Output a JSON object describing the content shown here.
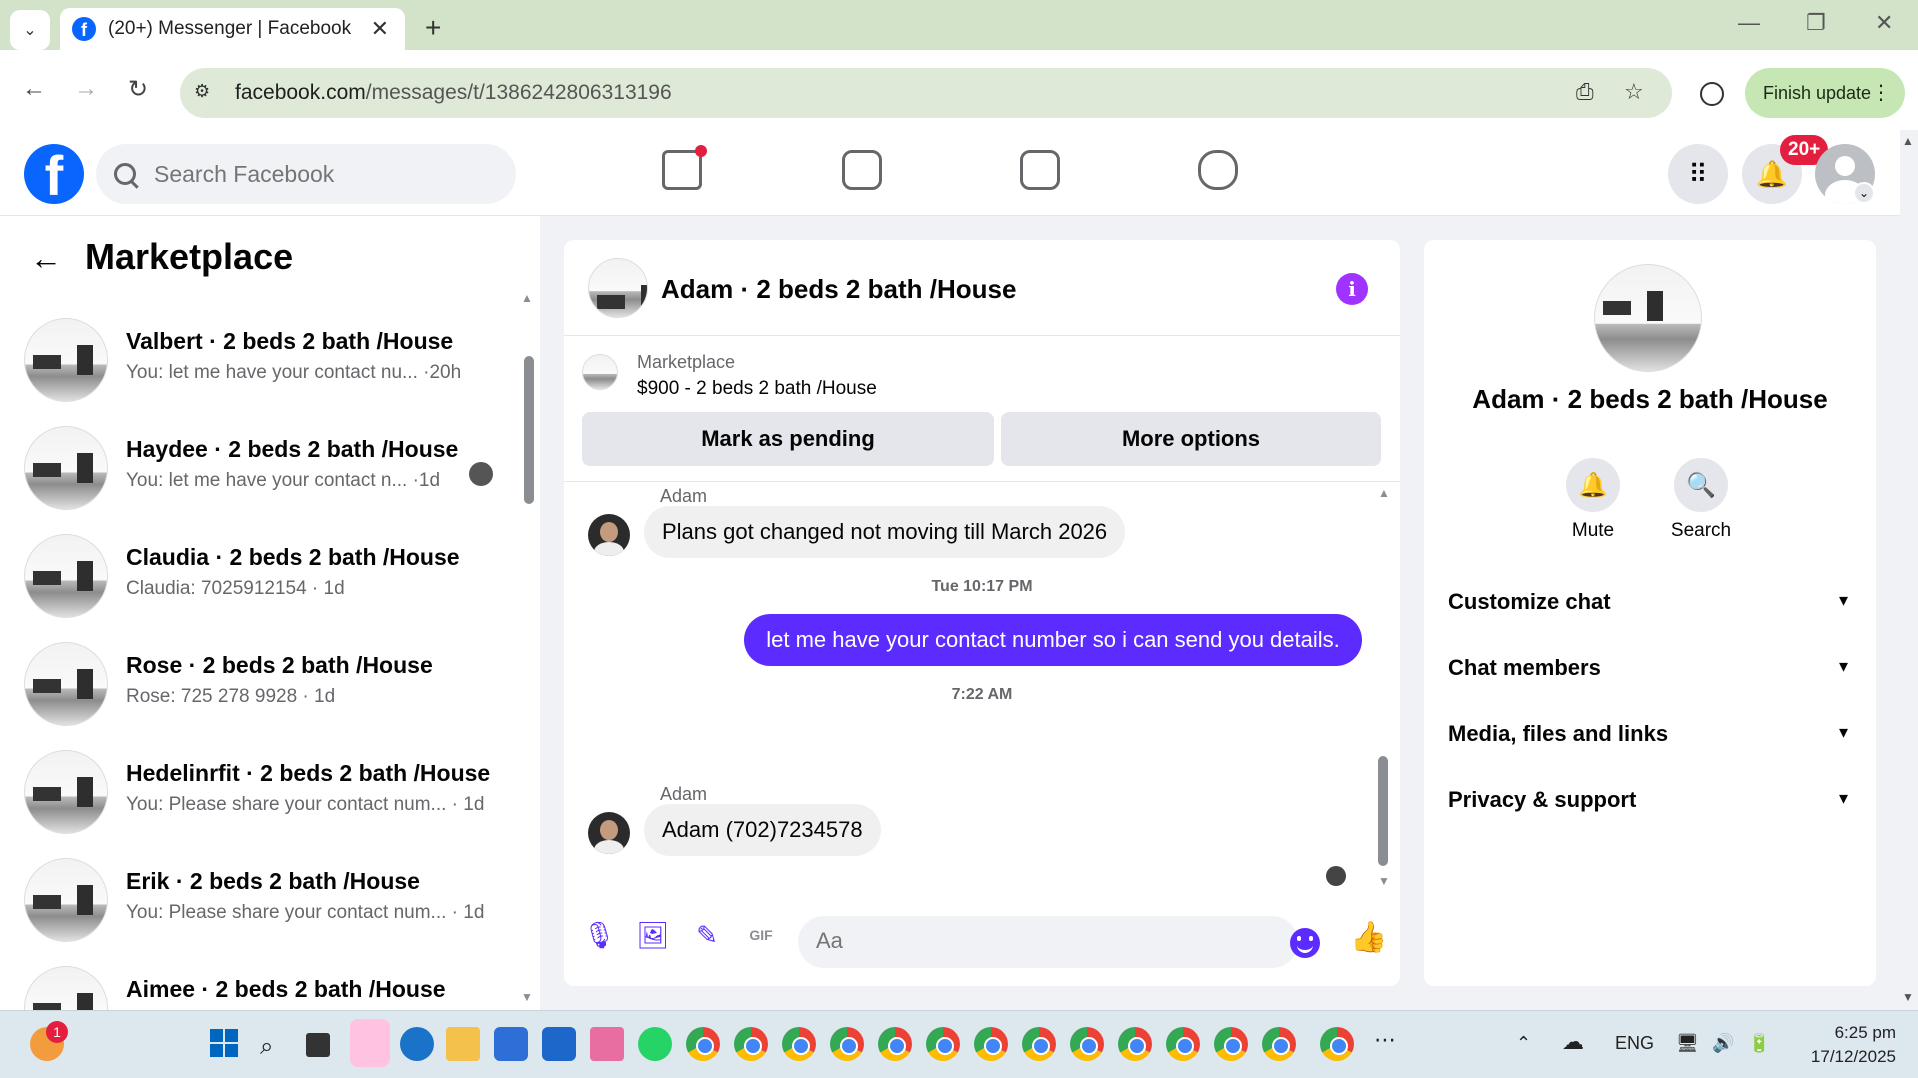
{
  "browser": {
    "tab_title": "(20+) Messenger | Facebook",
    "url_domain": "facebook.com",
    "url_path": "/messages/t/1386242806313196",
    "finish_update": "Finish update"
  },
  "fb": {
    "search_placeholder": "Search Facebook",
    "notif_badge": "20+"
  },
  "sidebar": {
    "title": "Marketplace",
    "conversations": [
      {
        "name": "Valbert · 2 beds 2 bath /House",
        "snippet": "You: let me have your contact nu...  ·20h"
      },
      {
        "name": "Haydee · 2 beds 2 bath /House",
        "snippet": "You: let me have your contact n... ·1d"
      },
      {
        "name": "Claudia · 2 beds 2 bath /House",
        "snippet": "Claudia: 7025912154 · 1d"
      },
      {
        "name": "Rose · 2 beds 2 bath /House",
        "snippet": "Rose: 725 278 9928 · 1d"
      },
      {
        "name": "Hedelinrfit · 2 beds 2 bath /House",
        "snippet": "You: Please share your contact num... · 1d"
      },
      {
        "name": "Erik · 2 beds 2 bath /House",
        "snippet": "You: Please share your contact num... · 1d"
      },
      {
        "name": "Aimee · 2 beds 2 bath /House",
        "snippet": ""
      }
    ]
  },
  "chat": {
    "title": "Adam · 2 beds 2 bath /House",
    "listing_category": "Marketplace",
    "listing_price": "$900 - 2 beds 2 bath /House",
    "mark_pending": "Mark as pending",
    "more_options": "More options",
    "messages": [
      {
        "sender": "Adam",
        "text": "Plans got changed not moving till March 2026"
      },
      {
        "timestamp": "Tue 10:17 PM"
      },
      {
        "text": "let me have your contact number so i can send you details."
      },
      {
        "timestamp": "7:22 AM"
      },
      {
        "sender": "Adam",
        "text": "Adam (702)7234578"
      }
    ],
    "composer_placeholder": "Aa"
  },
  "details": {
    "name": "Adam · 2 beds 2 bath /House",
    "mute": "Mute",
    "search": "Search",
    "sections": [
      "Customize chat",
      "Chat members",
      "Media, files and links",
      "Privacy & support"
    ]
  },
  "taskbar": {
    "notif_count": "1",
    "lang": "ENG",
    "time": "6:25 pm",
    "date": "17/12/2025"
  },
  "colors": {
    "fb_blue": "#0866ff",
    "messenger_purple": "#5b2bff",
    "info_purple": "#a033ff",
    "badge_red": "#e41e3f"
  }
}
